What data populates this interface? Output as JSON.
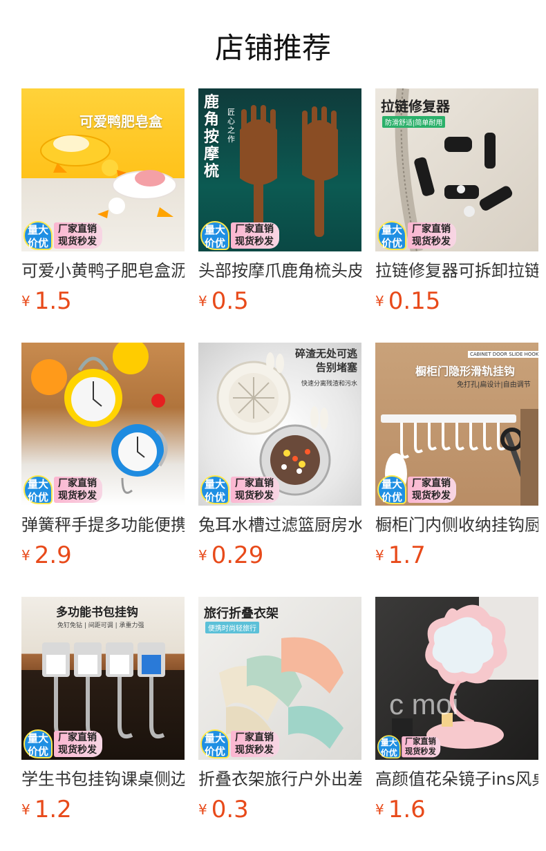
{
  "header": {
    "title": "店铺推荐"
  },
  "badge": {
    "line1": "量大",
    "line2": "价优",
    "line3": "厂家直销",
    "line4": "现货秒发"
  },
  "currency": "¥",
  "products": [
    {
      "name": "可爱小黄鸭子肥皂盒沥水",
      "price": "1.5",
      "headline": "可爱鸭肥皂盒",
      "sub": ""
    },
    {
      "name": "头部按摩爪鹿角梳头皮",
      "price": "0.5",
      "headline": "鹿角按摩梳",
      "sub": "匠心之作"
    },
    {
      "name": "拉链修复器可拆卸拉链头",
      "price": "0.15",
      "headline": "拉链修复器",
      "sub": "防滑舒适|简单耐用"
    },
    {
      "name": "弹簧秤手提多功能便携式",
      "price": "2.9",
      "headline": "",
      "sub": ""
    },
    {
      "name": "兔耳水槽过滤篮厨房水池",
      "price": "0.29",
      "headline": "碎渣无处可逃 告别堵塞",
      "sub": "快速分离残渣和污水"
    },
    {
      "name": "橱柜门内侧收纳挂钩厨房",
      "price": "1.7",
      "headline": "橱柜门隐形滑轨挂钩",
      "sub": "免打孔|扁设计|自由调节",
      "tag": "CABINET DOOR SLIDE HOOK"
    },
    {
      "name": "学生书包挂钩课桌侧边挂",
      "price": "1.2",
      "headline": "多功能书包挂钩",
      "sub": "免钉免钻 | 间距可调 | 承重力强"
    },
    {
      "name": "折叠衣架旅行户外出差便携",
      "price": "0.3",
      "headline": "旅行折叠衣架",
      "sub": "便携时尚轻旅行"
    },
    {
      "name": "高颜值花朵镜子ins风桌面",
      "price": "1.6",
      "headline": "",
      "sub": ""
    }
  ]
}
